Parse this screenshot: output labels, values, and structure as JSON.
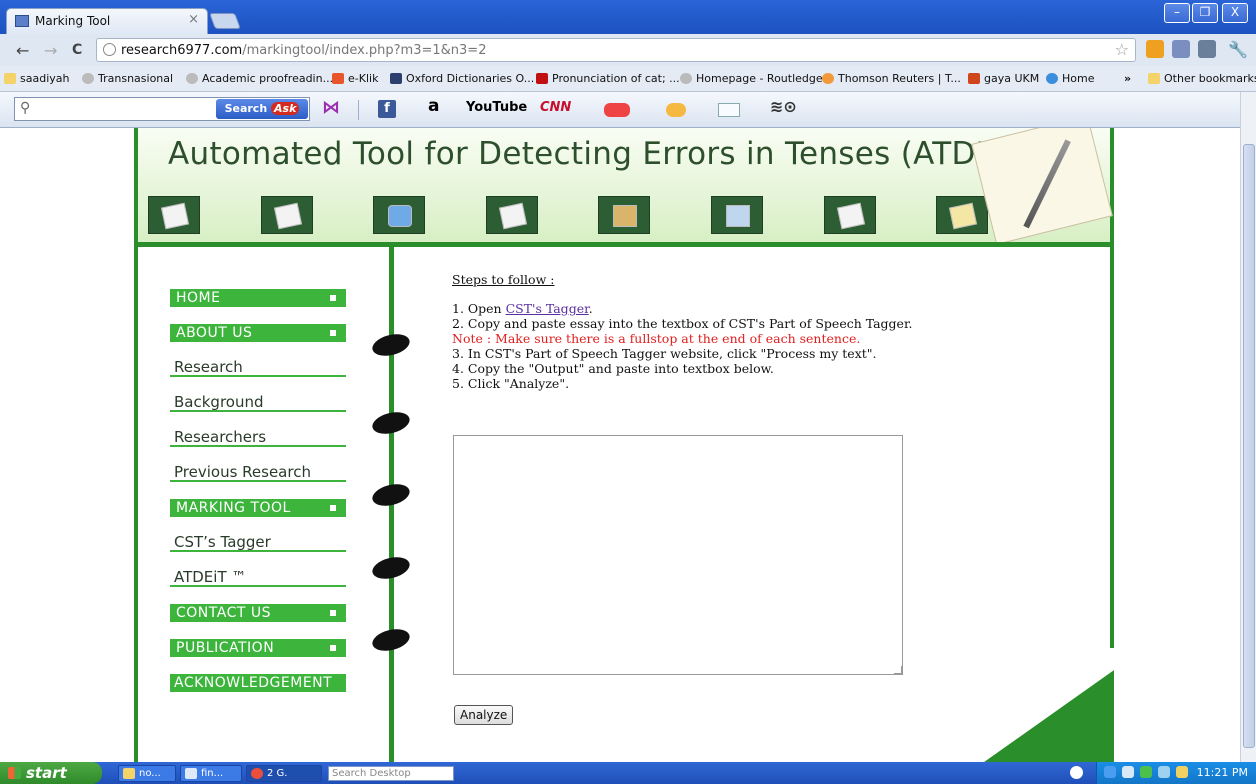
{
  "browser": {
    "tab_title": "Marking Tool",
    "tab_close": "×",
    "url_host": "research6977.com",
    "url_rest": "/markingtool/index.php?m3=1&n3=2",
    "back": "←",
    "forward": "→",
    "reload": "C",
    "bookmark_star": "☆",
    "window_min": "–",
    "window_max": "❐",
    "window_close": "X"
  },
  "bookmarks": {
    "items": [
      "saadiyah",
      "Transnasional",
      "Academic proofreadin...",
      "e-Klik",
      "Oxford Dictionaries O...",
      "Pronunciation of cat; ...",
      "Homepage - Routledge",
      "Thomson Reuters | T...",
      "gaya UKM",
      "Home"
    ],
    "overflow": "»",
    "other": "Other bookmarks"
  },
  "ask_toolbar": {
    "search_button": "Search",
    "search_brand": "Ask",
    "amazon": "a",
    "youtube": "YouTube",
    "cnn": "CNN"
  },
  "site": {
    "title": "Automated Tool for Detecting Errors in Tenses (ATDEiT)",
    "trademark": "TM"
  },
  "nav": {
    "home": "HOME",
    "about": "ABOUT US",
    "research": "Research",
    "background": "Background",
    "researchers": "Researchers",
    "previous": "Previous Research",
    "marking": "MARKING TOOL",
    "tagger": "CST’s Tagger",
    "atdeit": "ATDEiT ™",
    "contact": "CONTACT US",
    "publication": "PUBLICATION",
    "acknowledgement": "ACKNOWLEDGEMENT"
  },
  "content": {
    "steps_title": "Steps to follow :",
    "step1_prefix": "1. Open ",
    "step1_link": "CST's Tagger",
    "step1_suffix": ".",
    "step2": "2. Copy and paste essay into the textbox of CST's Part of Speech Tagger.",
    "note": "Note : Make sure there is a fullstop at the end of each sentence.",
    "step3": "3. In CST's Part of Speech Tagger website, click \"Process my text\".",
    "step4": "4. Copy the \"Output\" and paste into textbox below.",
    "step5": "5. Click \"Analyze\".",
    "textbox_value": "",
    "analyze_button": "Analyze"
  },
  "taskbar": {
    "start": "start",
    "tasks": [
      "no...",
      "fin...",
      "2 G."
    ],
    "search_desktop": "Search Desktop",
    "clock": "11:21 PM"
  },
  "colors": {
    "green": "#2a8f2a",
    "menu_green": "#3db53d",
    "note_red": "#e02020",
    "link_purple": "#5a2ea0"
  }
}
